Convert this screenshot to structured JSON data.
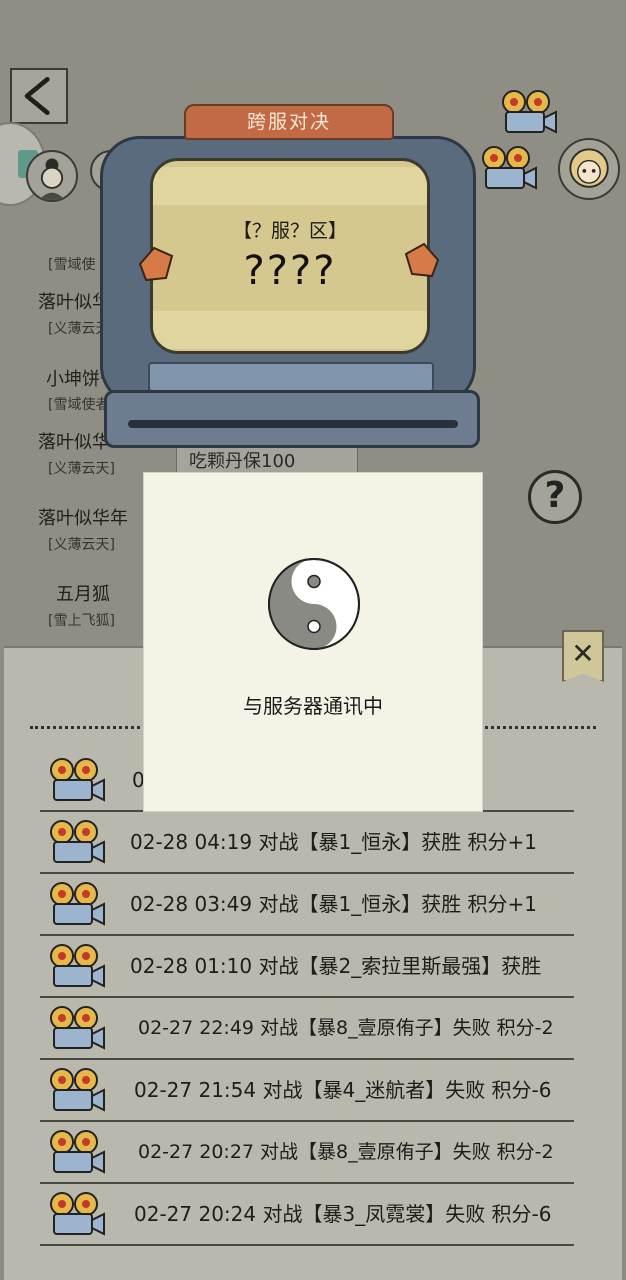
{
  "tv": {
    "title": "跨服对决",
    "subtitle": "【？服？区】",
    "main": "????"
  },
  "ad_text": "吃颗丹保100",
  "help_label": "?",
  "close_label": "✕",
  "players": [
    {
      "name": "",
      "guild": "[雪域使"
    },
    {
      "name": "落叶似华",
      "guild": "[义薄云天"
    },
    {
      "name": "小坤饼干",
      "guild": "[雪域使者"
    },
    {
      "name": "落叶似华",
      "guild": "[义薄云天]"
    },
    {
      "name": "落叶似华年",
      "guild": "[义薄云天]"
    },
    {
      "name": "五月狐",
      "guild": "[雪上飞狐]"
    }
  ],
  "modal": {
    "message": "与服务器通讯中"
  },
  "records": [
    {
      "text": "02-28 0             败 积分-7"
    },
    {
      "text": "02-28 04:19 对战【暴1_恒永】获胜 积分+1"
    },
    {
      "text": "02-28 03:49 对战【暴1_恒永】获胜 积分+1"
    },
    {
      "text": "02-28 01:10 对战【暴2_索拉里斯最强】获胜"
    },
    {
      "text": "02-27 22:49 对战【暴8_壹原侑子】失败 积分-2"
    },
    {
      "text": "02-27 21:54 对战【暴4_迷航者】失败 积分-6"
    },
    {
      "text": "02-27 20:27 对战【暴8_壹原侑子】失败 积分-2"
    },
    {
      "text": "02-27 20:24 对战【暴3_凤霓裳】失败 积分-6"
    }
  ]
}
